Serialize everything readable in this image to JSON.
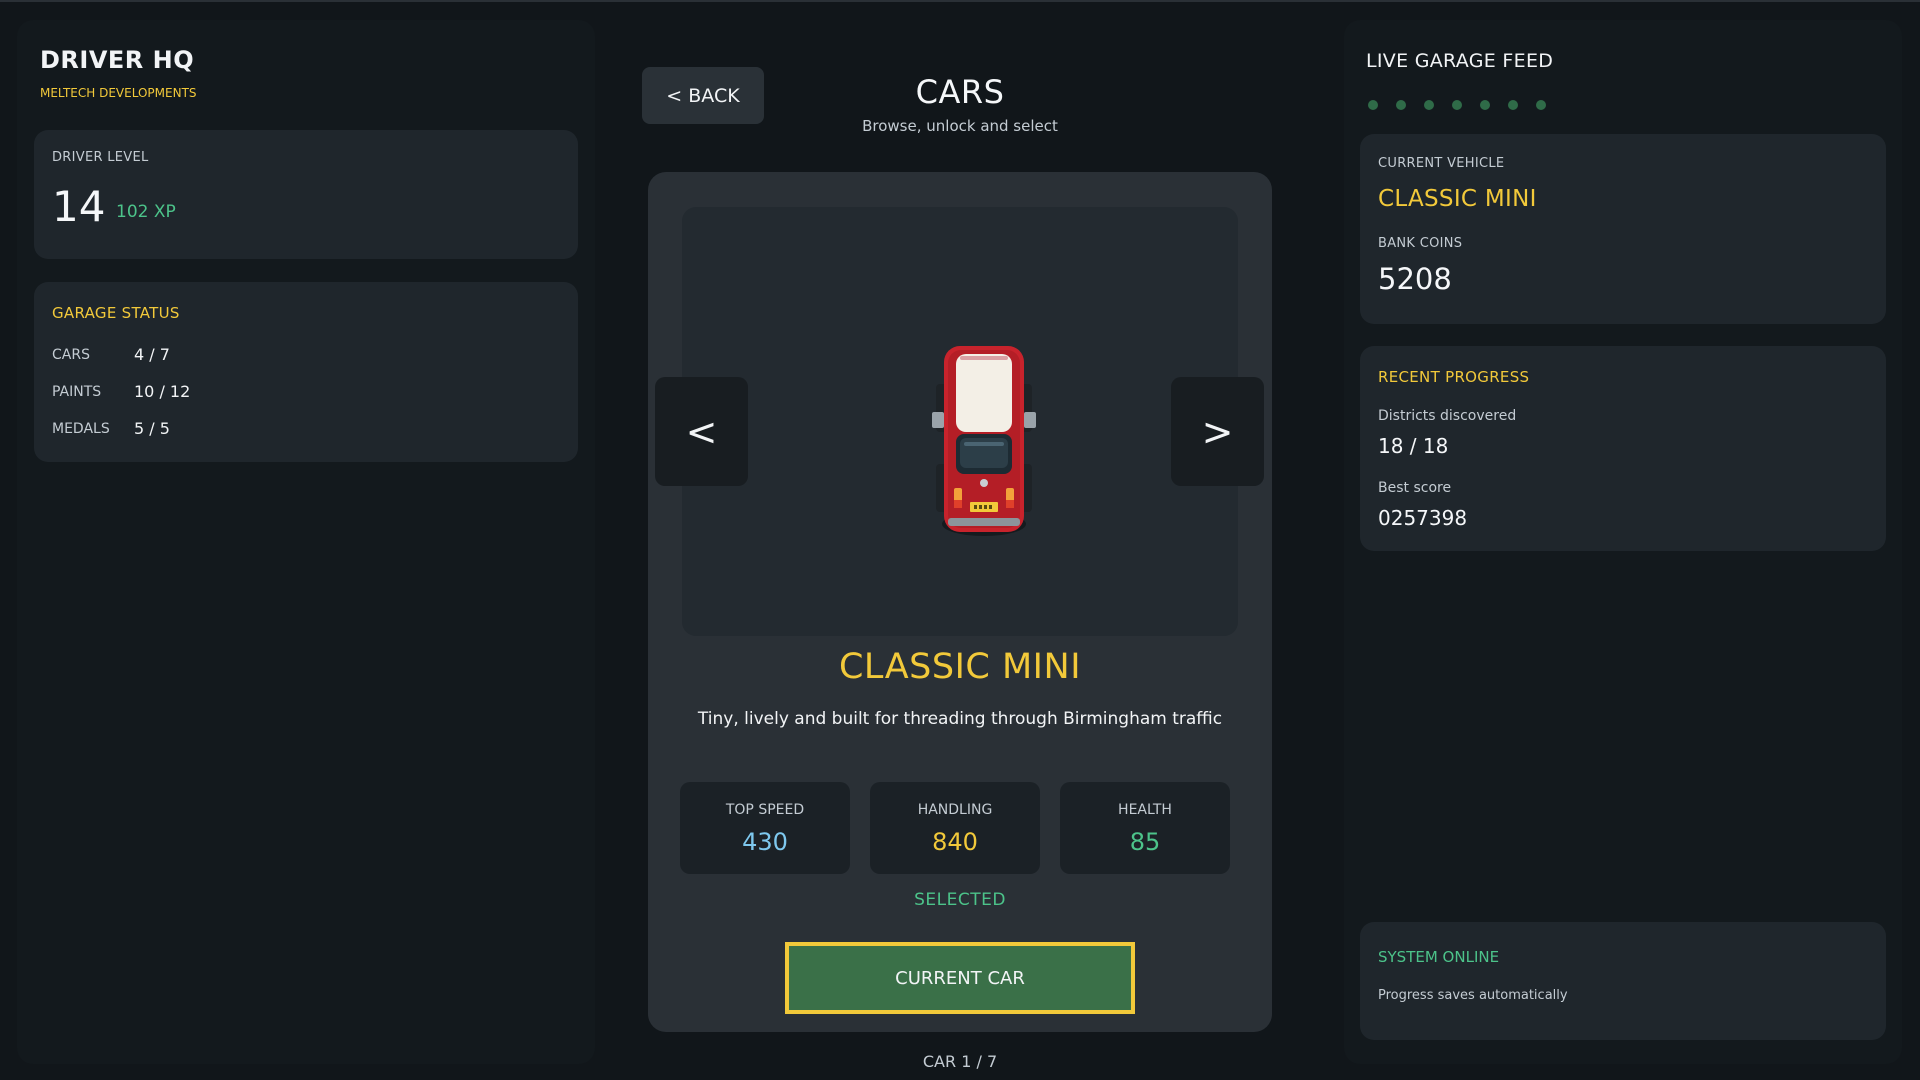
{
  "left": {
    "brand_title": "DRIVER HQ",
    "brand_subtitle": "MELTECH DEVELOPMENTS",
    "driver_level_label": "DRIVER LEVEL",
    "driver_level": "14",
    "xp": "102 XP",
    "garage_status_label": "GARAGE STATUS",
    "stats": [
      {
        "label": "CARS",
        "value": "4 / 7"
      },
      {
        "label": "PAINTS",
        "value": "10 / 12"
      },
      {
        "label": "MEDALS",
        "value": "5 / 5"
      }
    ]
  },
  "center": {
    "back_label": "< BACK",
    "title": "CARS",
    "subtitle": "Browse, unlock and select",
    "prev_label": "<",
    "next_label": ">",
    "car_name": "CLASSIC MINI",
    "car_description": "Tiny, lively and built for threading through Birmingham traffic",
    "car_stats": [
      {
        "label": "TOP SPEED",
        "value": "430",
        "color": "#7ec8ee"
      },
      {
        "label": "HANDLING",
        "value": "840",
        "color": "#f2c93a"
      },
      {
        "label": "HEALTH",
        "value": "85",
        "color": "#4cc38a"
      }
    ],
    "selected_label": "SELECTED",
    "current_button_label": "CURRENT CAR",
    "counter": "CAR 1 / 7"
  },
  "right": {
    "feed_title": "LIVE GARAGE FEED",
    "dot_count": 7,
    "current_vehicle_label": "CURRENT VEHICLE",
    "current_vehicle": "CLASSIC MINI",
    "bank_coins_label": "BANK COINS",
    "bank_coins": "5208",
    "recent_progress_label": "RECENT PROGRESS",
    "districts_label": "Districts discovered",
    "districts_value": "18 / 18",
    "best_score_label": "Best score",
    "best_score_value": "0257398",
    "system_status": "SYSTEM ONLINE",
    "system_note": "Progress saves automatically"
  },
  "colors": {
    "accent_gold": "#f2c93a",
    "accent_green": "#4cc38a",
    "button_green": "#3a7048",
    "car_red": "#c8232c"
  },
  "icons": {
    "car_sprite": "red-classic-mini-top-down"
  }
}
